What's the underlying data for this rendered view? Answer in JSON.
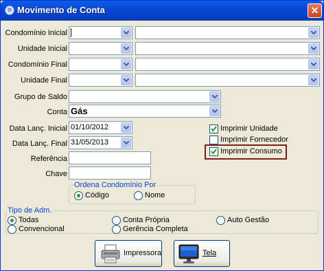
{
  "window": {
    "title": "Movimento de Conta",
    "close_glyph": "✕"
  },
  "fields": {
    "condominio_inicial": {
      "label": "Condomínio Inicial",
      "code": "",
      "name": ""
    },
    "unidade_inicial": {
      "label": "Unidade Inicial",
      "code": "",
      "name": ""
    },
    "condominio_final": {
      "label": "Condomínio Final",
      "code": "",
      "name": ""
    },
    "unidade_final": {
      "label": "Unidade Final",
      "code": "",
      "name": ""
    },
    "grupo_saldo": {
      "label": "Grupo de Saldo",
      "value": ""
    },
    "conta": {
      "label": "Conta",
      "value": "Gás"
    },
    "data_inicial": {
      "label": "Data Lanç. Inicial",
      "value": "01/10/2012"
    },
    "data_final": {
      "label": "Data Lanç. Final",
      "value": "31/05/2013"
    },
    "referencia": {
      "label": "Referência",
      "value": ""
    },
    "chave": {
      "label": "Chave",
      "value": ""
    }
  },
  "checkboxes": [
    {
      "label": "Imprimir Unidade",
      "checked": true
    },
    {
      "label": "Imprimir Fornecedor",
      "checked": false
    },
    {
      "label": "Imprimir Consumo",
      "checked": true
    }
  ],
  "ordena": {
    "title": "Ordena Condomínio Por",
    "options": [
      {
        "label": "Código",
        "selected": true
      },
      {
        "label": "Nome",
        "selected": false
      }
    ]
  },
  "tipo_adm": {
    "title": "Tipo de Adm.",
    "options": [
      {
        "label": "Todas",
        "selected": true
      },
      {
        "label": "Conta Própria",
        "selected": false
      },
      {
        "label": "Auto Gestão",
        "selected": false
      },
      {
        "label": "Convencional",
        "selected": false
      },
      {
        "label": "Gerência Completa",
        "selected": false
      }
    ]
  },
  "buttons": {
    "impressora": "Impressora",
    "tela": "Tela"
  },
  "colors": {
    "accent": "#0046d5",
    "highlight_border": "#7a1f1f",
    "radio_dot": "#21a121"
  }
}
